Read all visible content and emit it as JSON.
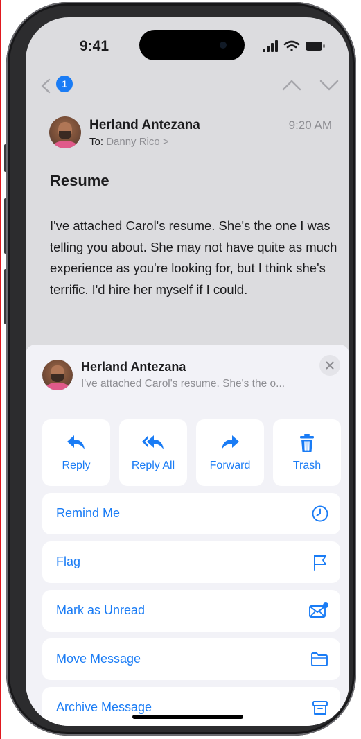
{
  "status_bar": {
    "time": "9:41"
  },
  "nav": {
    "unread_count": "1"
  },
  "message": {
    "sender": "Herland Antezana",
    "to_label": "To:",
    "recipient": "Danny Rico >",
    "time": "9:20 AM",
    "subject": "Resume",
    "body": "I've attached Carol's resume. She's the one I was telling you about. She may not have quite as much experience as you're looking for, but I think she's terrific. I'd hire her myself if I could."
  },
  "sheet": {
    "sender": "Herland Antezana",
    "preview": "I've attached Carol's resume. She's the o...",
    "actions": [
      {
        "label": "Reply",
        "icon": "reply-icon"
      },
      {
        "label": "Reply All",
        "icon": "reply-all-icon"
      },
      {
        "label": "Forward",
        "icon": "forward-icon"
      },
      {
        "label": "Trash",
        "icon": "trash-icon"
      }
    ],
    "rows": [
      {
        "label": "Remind Me",
        "icon": "clock-icon"
      },
      {
        "label": "Flag",
        "icon": "flag-icon"
      },
      {
        "label": "Mark as Unread",
        "icon": "envelope-unread-icon"
      },
      {
        "label": "Move Message",
        "icon": "folder-icon"
      },
      {
        "label": "Archive Message",
        "icon": "archive-box-icon"
      }
    ]
  },
  "colors": {
    "accent": "#1a7cf5",
    "background_dimmed": "#dcdcdf",
    "sheet_background": "#f2f2f7",
    "secondary_text": "#8e8e93"
  }
}
